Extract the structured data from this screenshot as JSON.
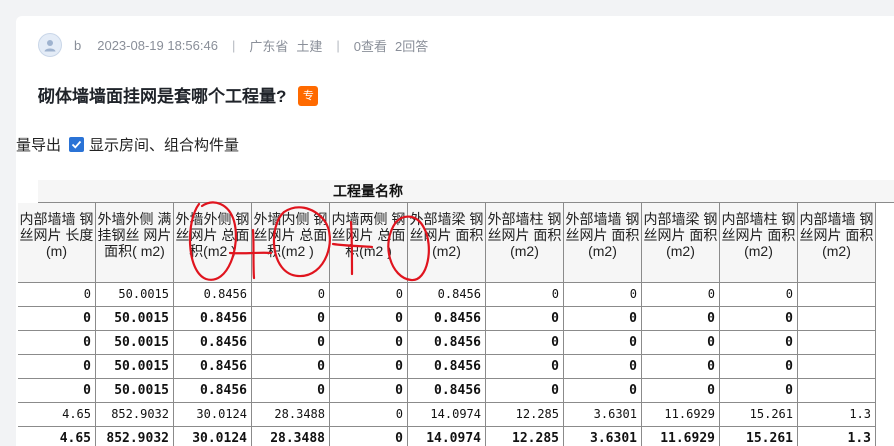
{
  "meta": {
    "author": "b",
    "datetime": "2023-08-19 18:56:46",
    "region": "广东省",
    "category": "土建",
    "views": "0查看",
    "answers": "2回答"
  },
  "question": {
    "title": "砌体墙墙面挂网是套哪个工程量?",
    "badge": "专"
  },
  "software": {
    "export_label": "量导出",
    "checkbox_label": "显示房间、组合构件量",
    "group_header": "工程量名称",
    "columns": [
      "内部墙墙 钢丝网片 长度(m)",
      "外墙外侧 满挂钢丝 网片面积( m2)",
      "外墙外侧 钢丝网片 总面积(m2 )",
      "外墙内侧 钢丝网片 总面积(m2 )",
      "内墙两侧 钢丝网片 总面积(m2 )",
      "外部墙梁 钢丝网片 面积(m2)",
      "外部墙柱 钢丝网片 面积(m2)",
      "外部墙墙 钢丝网片 面积(m2)",
      "内部墙梁 钢丝网片 面积(m2)",
      "内部墙柱 钢丝网片 面积(m2)",
      "内部墙墙 钢丝网片 面积(m2)"
    ],
    "rows": [
      {
        "bold": false,
        "cells": [
          "0",
          "50.0015",
          "0.8456",
          "0",
          "0",
          "0.8456",
          "0",
          "0",
          "0",
          "0",
          ""
        ]
      },
      {
        "bold": true,
        "cells": [
          "0",
          "50.0015",
          "0.8456",
          "0",
          "0",
          "0.8456",
          "0",
          "0",
          "0",
          "0",
          ""
        ]
      },
      {
        "bold": true,
        "cells": [
          "0",
          "50.0015",
          "0.8456",
          "0",
          "0",
          "0.8456",
          "0",
          "0",
          "0",
          "0",
          ""
        ]
      },
      {
        "bold": true,
        "cells": [
          "0",
          "50.0015",
          "0.8456",
          "0",
          "0",
          "0.8456",
          "0",
          "0",
          "0",
          "0",
          ""
        ]
      },
      {
        "bold": true,
        "cells": [
          "0",
          "50.0015",
          "0.8456",
          "0",
          "0",
          "0.8456",
          "0",
          "0",
          "0",
          "0",
          ""
        ]
      },
      {
        "bold": false,
        "cells": [
          "4.65",
          "852.9032",
          "30.0124",
          "28.3488",
          "0",
          "14.0974",
          "12.285",
          "3.6301",
          "11.6929",
          "15.261",
          "1.3"
        ]
      },
      {
        "bold": true,
        "cells": [
          "4.65",
          "852.9032",
          "30.0124",
          "28.3488",
          "0",
          "14.0974",
          "12.285",
          "3.6301",
          "11.6929",
          "15.261",
          "1.3"
        ]
      }
    ]
  },
  "colors": {
    "badge": "#ff6a00",
    "checkbox": "#2a73d6",
    "annotation": "#e0141e"
  }
}
